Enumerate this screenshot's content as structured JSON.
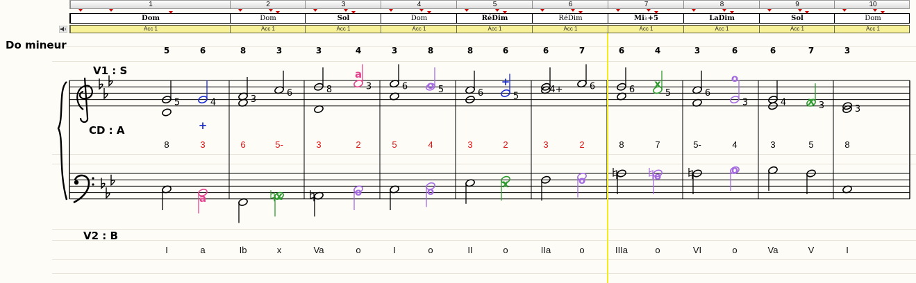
{
  "key_label": "Do mineur",
  "voice_top_label": "V1 : S",
  "voice_mid_label": "CD : A",
  "voice_bottom_label": "V2 : B",
  "ruler": {
    "measures": [
      "1",
      "2",
      "3",
      "4",
      "5",
      "6",
      "7",
      "8",
      "9",
      "10"
    ]
  },
  "chords": [
    {
      "label": "Dom",
      "bold": true
    },
    {
      "label": "Dom",
      "bold": false
    },
    {
      "label": "Sol",
      "bold": true
    },
    {
      "label": "Dom",
      "bold": false
    },
    {
      "label": "RéDim",
      "bold": true
    },
    {
      "label": "RéDim",
      "bold": false
    },
    {
      "label": "Mi♭+5",
      "bold": true
    },
    {
      "label": "LaDim",
      "bold": true
    },
    {
      "label": "Sol",
      "bold": true
    },
    {
      "label": "Dom",
      "bold": false
    }
  ],
  "acc_label": "Acc 1",
  "top_figures": [
    "5",
    "6",
    "8",
    "3",
    "3",
    "4",
    "3",
    "8",
    "8",
    "6",
    "6",
    "7",
    "6",
    "4",
    "3",
    "6",
    "6",
    "7",
    "3"
  ],
  "intervals": [
    {
      "text": "8",
      "color": "#000000"
    },
    {
      "text": "3",
      "color": "#e01010"
    },
    {
      "text": "6",
      "color": "#e01010"
    },
    {
      "text": "5-",
      "color": "#e01010"
    },
    {
      "text": "3",
      "color": "#e01010"
    },
    {
      "text": "2",
      "color": "#e01010"
    },
    {
      "text": "5",
      "color": "#e01010"
    },
    {
      "text": "4",
      "color": "#e01010"
    },
    {
      "text": "3",
      "color": "#e01010"
    },
    {
      "text": "2",
      "color": "#e01010"
    },
    {
      "text": "3",
      "color": "#e01010"
    },
    {
      "text": "2",
      "color": "#e01010"
    },
    {
      "text": "8",
      "color": "#000000"
    },
    {
      "text": "7",
      "color": "#000000"
    },
    {
      "text": "5-",
      "color": "#000000"
    },
    {
      "text": "4",
      "color": "#000000"
    },
    {
      "text": "3",
      "color": "#000000"
    },
    {
      "text": "5",
      "color": "#000000"
    },
    {
      "text": "8",
      "color": "#000000"
    }
  ],
  "roman_numerals": [
    "I",
    "a",
    "Ib",
    "x",
    "Va",
    "o",
    "I",
    "o",
    "II",
    "o",
    "IIa",
    "o",
    "IIIa",
    "o",
    "VI",
    "o",
    "Va",
    "V",
    "I"
  ],
  "note_figures": [
    "5",
    "4",
    "3",
    "6",
    "8",
    "3",
    "6",
    "5",
    "6",
    "5",
    "4+",
    "6",
    "6",
    "5",
    "6",
    "3",
    "4",
    "3",
    "3"
  ],
  "ornaments": {
    "a": "a",
    "o": "o",
    "x": "x",
    "plus": "+"
  },
  "colors": {
    "black": "#000000",
    "red": "#e01010",
    "blue": "#1a2bd0",
    "pink": "#e2458f",
    "purple": "#a56ce0",
    "green": "#2e9a2e",
    "acc_bg": "#f7f29a",
    "playhead": "#f5ea1c"
  }
}
